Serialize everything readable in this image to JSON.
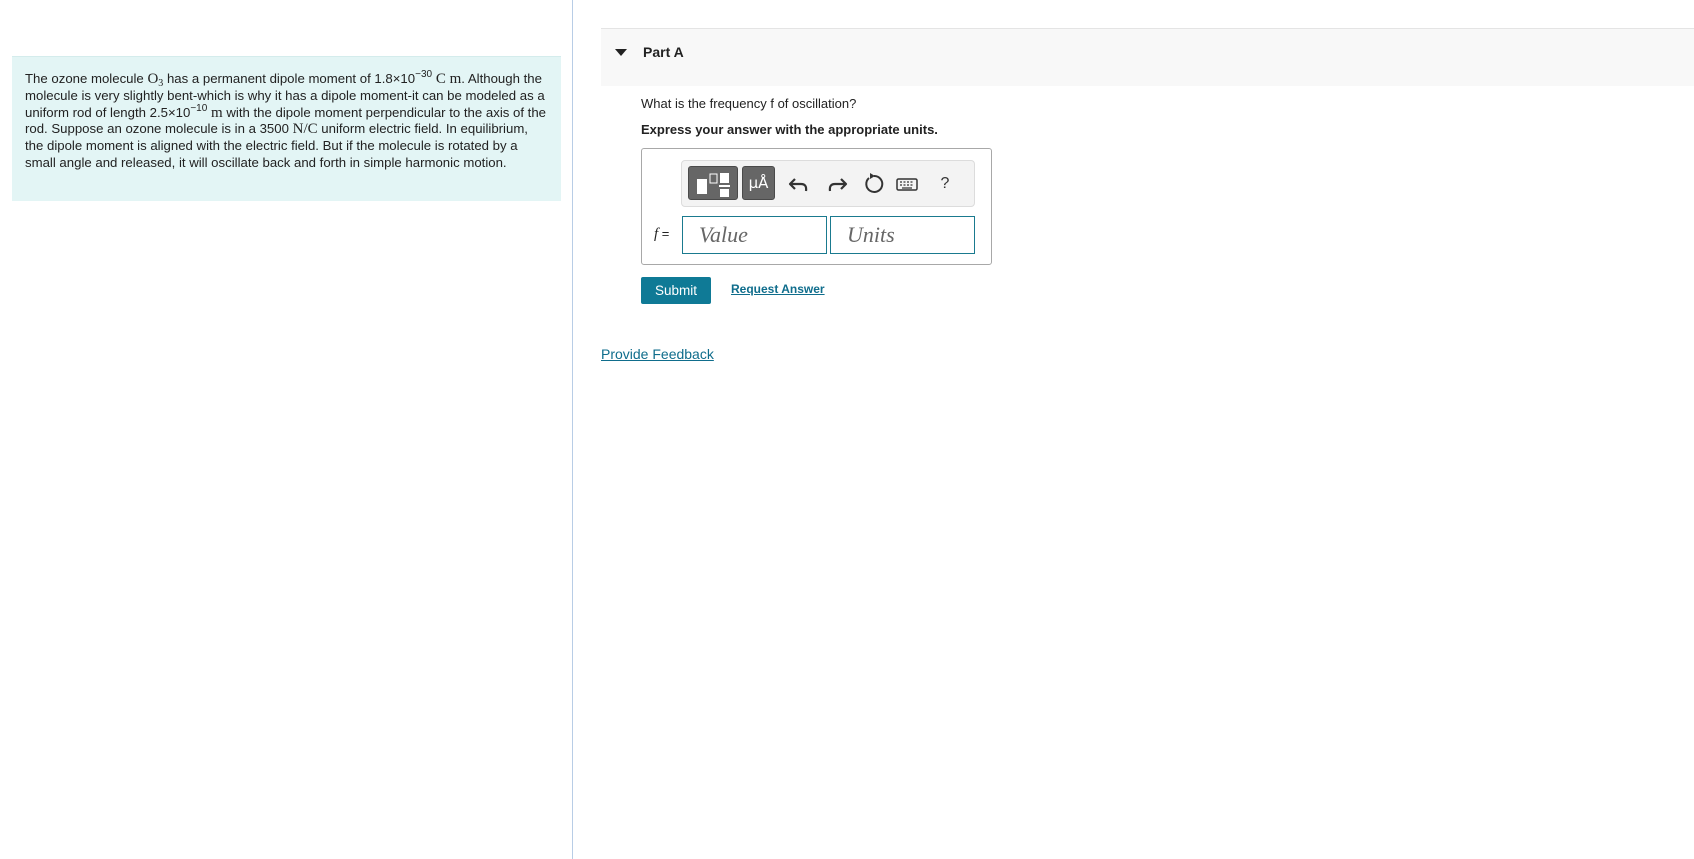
{
  "problem": {
    "t1": "The ozone molecule ",
    "o": "O",
    "o_sub": "3",
    "t2": " has a permanent dipole moment of 1.8×10",
    "exp1": "−30",
    "u1": " C m",
    "t3": ". Although the molecule is very slightly bent-which is why it has a dipole moment-it can be modeled as a uniform rod of length 2.5×10",
    "exp2": "−10",
    "u2": " m",
    "t4": " with the dipole moment perpendicular to the axis of the rod. Suppose an ozone molecule is in a 3500 ",
    "u3": "N/C",
    "t5": " uniform electric field. In equilibrium, the dipole moment is aligned with the electric field. But if the molecule is rotated by a small angle and released, it will oscillate back and forth in simple harmonic motion."
  },
  "part": {
    "title": "Part A"
  },
  "question": "What is the frequency f of oscillation?",
  "instruction": "Express your answer with the appropriate units.",
  "toolbar": {
    "units_button": "μÅ",
    "undo_icon": "undo-icon",
    "redo_icon": "redo-icon",
    "reset_icon": "reset-icon",
    "keyboard_icon": "keyboard-icon",
    "help": "?"
  },
  "answer": {
    "variable": "f",
    "equals": " =",
    "value_placeholder": "Value",
    "units_placeholder": "Units"
  },
  "buttons": {
    "submit": "Submit",
    "request_answer": "Request Answer"
  },
  "feedback": "Provide Feedback",
  "colors": {
    "problem_bg": "#e3f5f5",
    "accent": "#0f7a96",
    "link": "#0f6d8c"
  }
}
